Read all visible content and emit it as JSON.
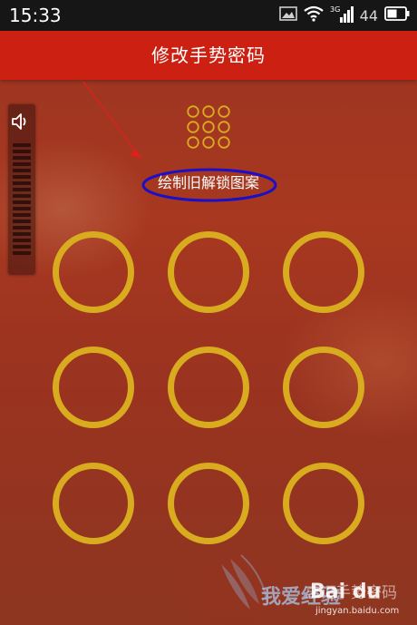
{
  "status_bar": {
    "time": "15:33",
    "network_label": "3G",
    "battery_level": "44",
    "icons": [
      "image-icon",
      "wifi-icon",
      "signal-icon",
      "battery-icon"
    ]
  },
  "title_bar": {
    "title": "修改手势密码"
  },
  "volume": {
    "icon": "speaker-icon",
    "level": 0
  },
  "lock_screen": {
    "hint": "绘制旧解锁图案",
    "pattern_rows": 3,
    "pattern_cols": 3,
    "forgot_link": "忘记手势密码"
  },
  "watermark": {
    "brand": "Bai du",
    "site_label": "我爱经验",
    "url": "jingyan.baidu.com"
  },
  "colors": {
    "status_bar": "#161616",
    "title_bar": "#cc2112",
    "ring": "#d9ac1f",
    "annotation_ellipse": "#1a10c8",
    "annotation_arrow": "#e0201a"
  }
}
